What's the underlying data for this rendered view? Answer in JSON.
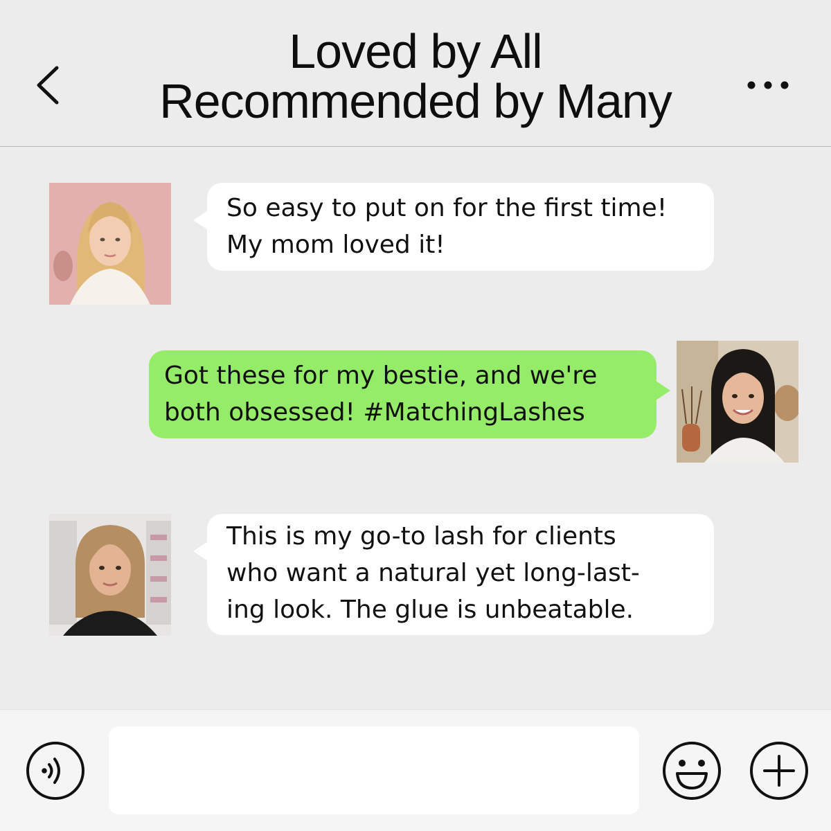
{
  "header": {
    "title_line1": "Loved by All",
    "title_line2": "Recommended by Many",
    "back_icon": "chevron-left-icon",
    "more_icon": "more-horizontal-icon"
  },
  "messages": [
    {
      "side": "left",
      "avatar": "avatar-girl-blonde",
      "lines": [
        "So easy to put on for the first time!",
        "My mom loved it!"
      ]
    },
    {
      "side": "right",
      "avatar": "avatar-girl-brunette",
      "lines": [
        "Got these for my bestie, and we're",
        "both obsessed! #MatchingLashes"
      ]
    },
    {
      "side": "left",
      "avatar": "avatar-woman-stylist",
      "lines": [
        "This is my go-to lash for clients",
        "who want a natural yet long-last-",
        "ing look. The glue is unbeatable."
      ]
    }
  ],
  "composer": {
    "value": "",
    "voice_icon": "voice-icon",
    "emoji_icon": "emoji-icon",
    "plus_icon": "plus-icon"
  },
  "colors": {
    "background": "#ececec",
    "bubble_left": "#ffffff",
    "bubble_right": "#95ec69",
    "text": "#111111"
  }
}
